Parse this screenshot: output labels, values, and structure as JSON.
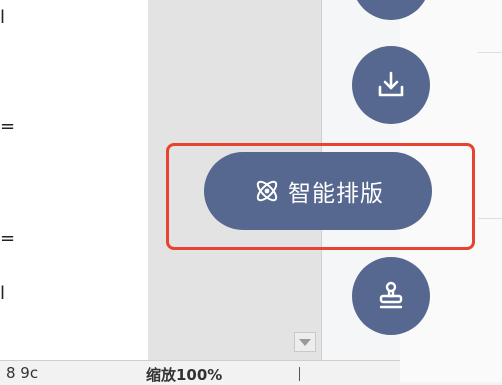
{
  "document": {
    "fragments": [
      "l",
      "=",
      "=",
      "l"
    ]
  },
  "actions": {
    "smart_layout_label": "智能排版",
    "top_button_icon": "circle-button",
    "download_icon": "download-icon",
    "smart_layout_icon": "atom-icon",
    "stamp_icon": "stamp-icon"
  },
  "status_bar": {
    "left_text": "8  9c",
    "zoom_text": "缩放100%"
  },
  "colors": {
    "button": "#56688f",
    "highlight": "#e8432f"
  }
}
